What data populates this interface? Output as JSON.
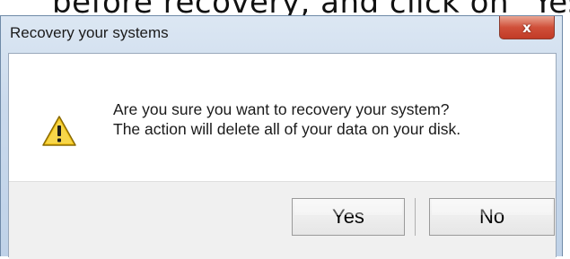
{
  "background_caption": "before recovery, and click on \"Yes",
  "dialog": {
    "title": "Recovery your systems",
    "close_glyph": "x",
    "icon": "warning-icon",
    "message_line1": "Are you sure you want to recovery your system?",
    "message_line2": "The action will delete all of your data on your disk.",
    "buttons": {
      "yes_label": "Yes",
      "no_label": "No"
    }
  },
  "colors": {
    "title_bar": "#c9d9ec",
    "close_button": "#d0503a",
    "warning_fill": "#f2c318",
    "button_bar": "#f0f0f0"
  }
}
